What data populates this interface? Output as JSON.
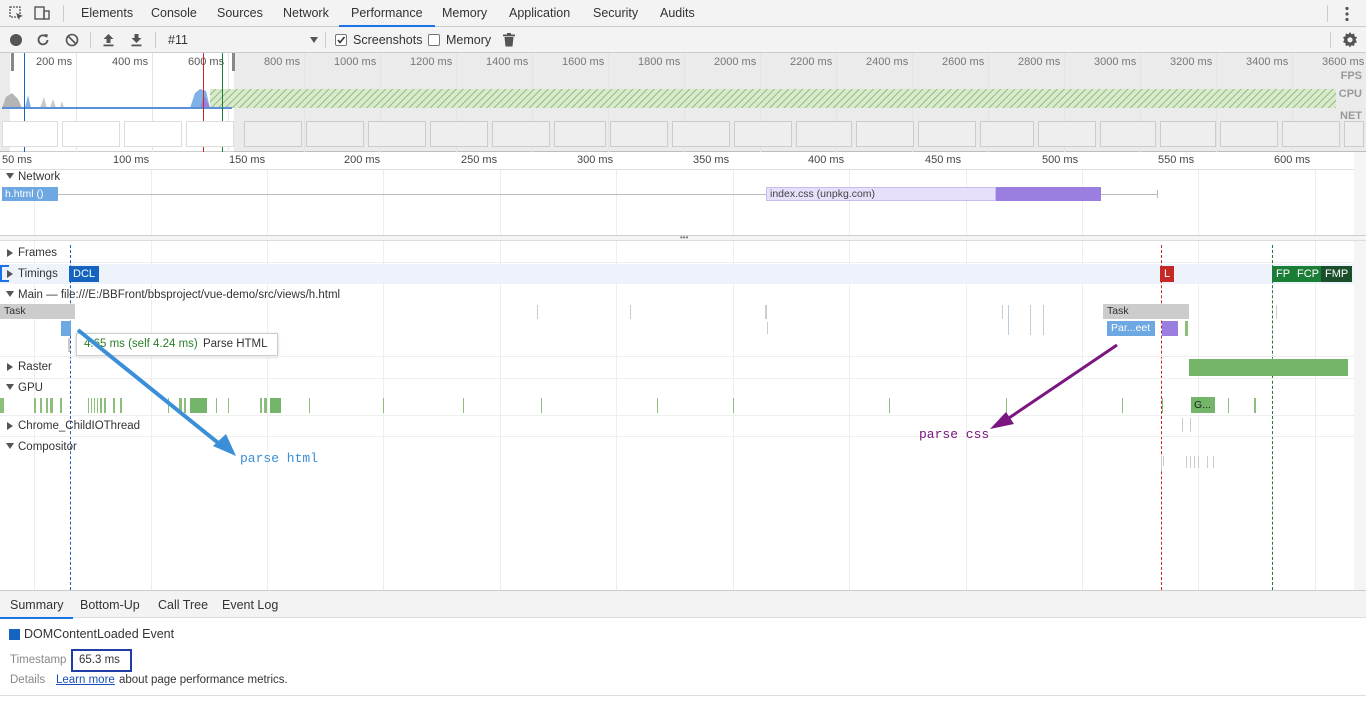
{
  "tabs": [
    "Elements",
    "Console",
    "Sources",
    "Network",
    "Performance",
    "Memory",
    "Application",
    "Security",
    "Audits"
  ],
  "active_tab": "Performance",
  "toolbar": {
    "profile": "#11",
    "screenshots_label": "Screenshots",
    "screenshots_checked": true,
    "memory_label": "Memory",
    "memory_checked": false
  },
  "overview": {
    "ticks": [
      "200 ms",
      "400 ms",
      "600 ms",
      "800 ms",
      "1000 ms",
      "1200 ms",
      "1400 ms",
      "1600 ms",
      "1800 ms",
      "2000 ms",
      "2200 ms",
      "2400 ms",
      "2600 ms",
      "2800 ms",
      "3000 ms",
      "3200 ms",
      "3400 ms",
      "3600 ms"
    ],
    "labels": [
      "FPS",
      "CPU",
      "NET"
    ]
  },
  "ruler": {
    "ticks": [
      "50 ms",
      "100 ms",
      "150 ms",
      "200 ms",
      "250 ms",
      "300 ms",
      "350 ms",
      "400 ms",
      "450 ms",
      "500 ms",
      "550 ms",
      "600 ms"
    ]
  },
  "network": {
    "title": "Network",
    "request1": "h.html ()",
    "request2": "index.css (unpkg.com)"
  },
  "tracks": {
    "frames": "Frames",
    "timings": "Timings",
    "main": "Main — file:///E:/BBFront/bbsproject/vue-demo/src/views/h.html",
    "raster": "Raster",
    "gpu": "GPU",
    "child_io": "Chrome_ChildIOThread",
    "compositor": "Compositor"
  },
  "markers": {
    "dcl": "DCL",
    "l": "L",
    "fp": "FP",
    "fcp": "FCP",
    "fmp": "FMP"
  },
  "main_events": {
    "task1": "Task",
    "task2": "Task",
    "parse_stylesheet": "Par...eet",
    "gpu_block": "G..."
  },
  "tooltip": {
    "time": "4.65 ms (self 4.24 ms)",
    "name": "Parse HTML"
  },
  "annotations": {
    "parse_html": "parse html",
    "parse_css": "parse css"
  },
  "bottom_tabs": [
    "Summary",
    "Bottom-Up",
    "Call Tree",
    "Event Log"
  ],
  "summary": {
    "event": "DOMContentLoaded Event",
    "timestamp_label": "Timestamp",
    "timestamp_value": "65.3 ms",
    "details_label": "Details",
    "learn_more": "Learn more",
    "details_suffix": "about page performance metrics."
  },
  "colors": {
    "accent": "#1a73e8",
    "dcl": "#1565c0",
    "load": "#c62828",
    "paint": "#1b7e36",
    "annotation_html": "#3a8fd8",
    "annotation_css": "#7b1680",
    "css_bar": "#9b7fe0"
  }
}
